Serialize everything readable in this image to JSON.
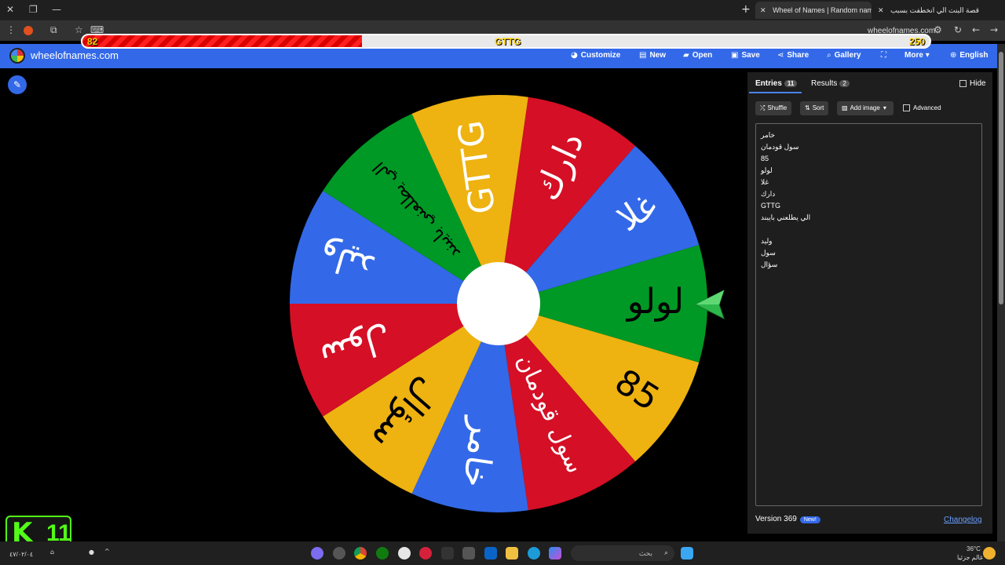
{
  "browser": {
    "tabs": [
      {
        "title": "Wheel of Names | Random nam",
        "active": true
      },
      {
        "title": "قصة البنت الي انخطفت بسبب",
        "active": false
      }
    ],
    "url": "wheelofnames.com"
  },
  "score": {
    "left": "82",
    "middle": "GTTG",
    "right": "250",
    "progress_fraction": 0.33
  },
  "app": {
    "brand": "wheelofnames.com",
    "menu": [
      {
        "icon": "palette-icon",
        "label": "Customize"
      },
      {
        "icon": "new-file-icon",
        "label": "New"
      },
      {
        "icon": "folder-icon",
        "label": "Open"
      },
      {
        "icon": "save-icon",
        "label": "Save"
      },
      {
        "icon": "share-icon",
        "label": "Share"
      },
      {
        "icon": "search-icon",
        "label": "Gallery"
      },
      {
        "icon": "fullscreen-icon",
        "label": ""
      },
      {
        "icon": "chevron-down-icon",
        "label": "More"
      },
      {
        "icon": "globe-icon",
        "label": "English"
      }
    ]
  },
  "wheel": {
    "colors": {
      "blue": "#3369e8",
      "red": "#d50f25",
      "yellow": "#eeb211",
      "green": "#009925"
    },
    "segments": [
      {
        "label": "لولو",
        "color": "#009925",
        "text_color": "#000000"
      },
      {
        "label": "85",
        "color": "#eeb211",
        "text_color": "#000000"
      },
      {
        "label": "سول قودمان",
        "color": "#d50f25",
        "text_color": "#ffffff"
      },
      {
        "label": "خامر",
        "color": "#3369e8",
        "text_color": "#ffffff"
      },
      {
        "label": "سؤال",
        "color": "#eeb211",
        "text_color": "#000000"
      },
      {
        "label": "سول",
        "color": "#d50f25",
        "text_color": "#ffffff"
      },
      {
        "label": "وليد",
        "color": "#3369e8",
        "text_color": "#ffffff"
      },
      {
        "label": "الي يطلعني بايبند",
        "color": "#009925",
        "text_color": "#000000"
      },
      {
        "label": "GTTG",
        "color": "#eeb211",
        "text_color": "#ffffff"
      },
      {
        "label": "دارك",
        "color": "#d50f25",
        "text_color": "#ffffff"
      },
      {
        "label": "غلا",
        "color": "#3369e8",
        "text_color": "#ffffff"
      }
    ]
  },
  "sidebar": {
    "tabs": [
      {
        "label": "Entries",
        "count": "11"
      },
      {
        "label": "Results",
        "count": "2"
      }
    ],
    "hide_label": "Hide",
    "tools": {
      "shuffle": "Shuffle",
      "sort": "Sort",
      "add_image": "Add image",
      "advanced": "Advanced"
    },
    "entries": [
      "خامر",
      "سول قودمان",
      "85",
      "لولو",
      "غلا",
      "دارك",
      "GTTG",
      "الي يطلعني بايبند",
      "",
      "وليد",
      "سول",
      "سؤال"
    ],
    "version": "Version 369",
    "new_badge": "New!",
    "changelog": "Changelog"
  },
  "kick": {
    "letter": "K",
    "number": "11"
  },
  "taskbar": {
    "search_placeholder": "بحث",
    "weather": "36°C",
    "weather_sub": "غالم جزئيا",
    "date": "٤٧/٠٢/٠٤"
  }
}
